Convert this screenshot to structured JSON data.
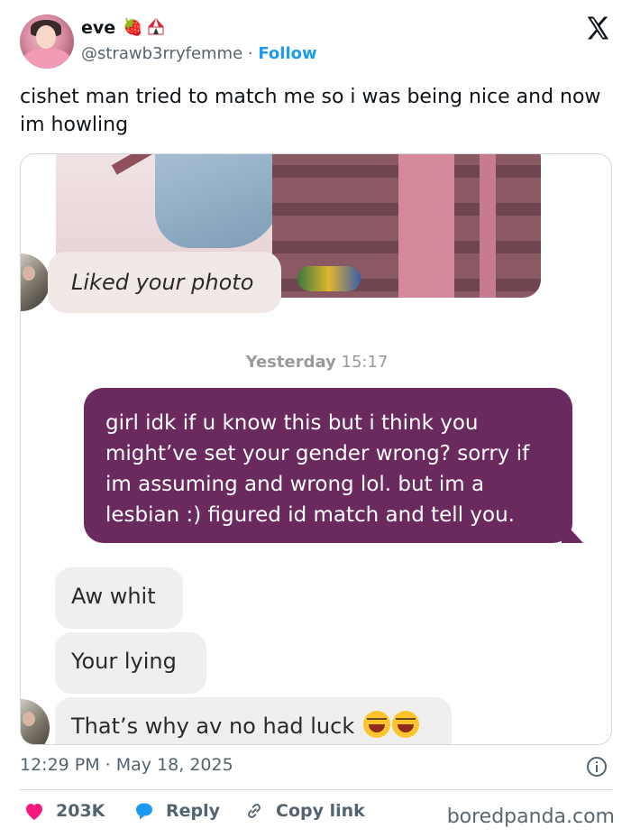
{
  "author": {
    "name": "eve",
    "handle": "@strawb3rryfemme",
    "separator": "·",
    "follow_label": "Follow"
  },
  "tweet": {
    "text": "cishet man tried to match me so i was being nice and now im howling"
  },
  "chat": {
    "liked_label": "Liked your photo",
    "timestamp_day": "Yesterday",
    "timestamp_time": "15:17",
    "sent_message": "girl idk if u know this but i think you might’ve set your gender wrong? sorry if im assuming and wrong lol. but im a lesbian :) figured id match and tell you.",
    "received": [
      "Aw whit",
      "Your lying",
      "That’s why av no had luck"
    ]
  },
  "footer": {
    "posted_at": "12:29 PM · May 18, 2025",
    "likes_count": "203K",
    "reply_label": "Reply",
    "copy_link_label": "Copy link",
    "watermark": "boredpanda.com"
  },
  "colors": {
    "follow": "#1d9bf0",
    "sent_bubble": "#6a2a5e",
    "like_heart": "#f91880",
    "reply_bubble": "#1d9bf0"
  },
  "icons": [
    "x-logo-icon",
    "strawberry-icon",
    "circus-tent-icon",
    "info-icon",
    "heart-icon",
    "reply-icon",
    "link-icon",
    "laughing-emoji-icon"
  ]
}
